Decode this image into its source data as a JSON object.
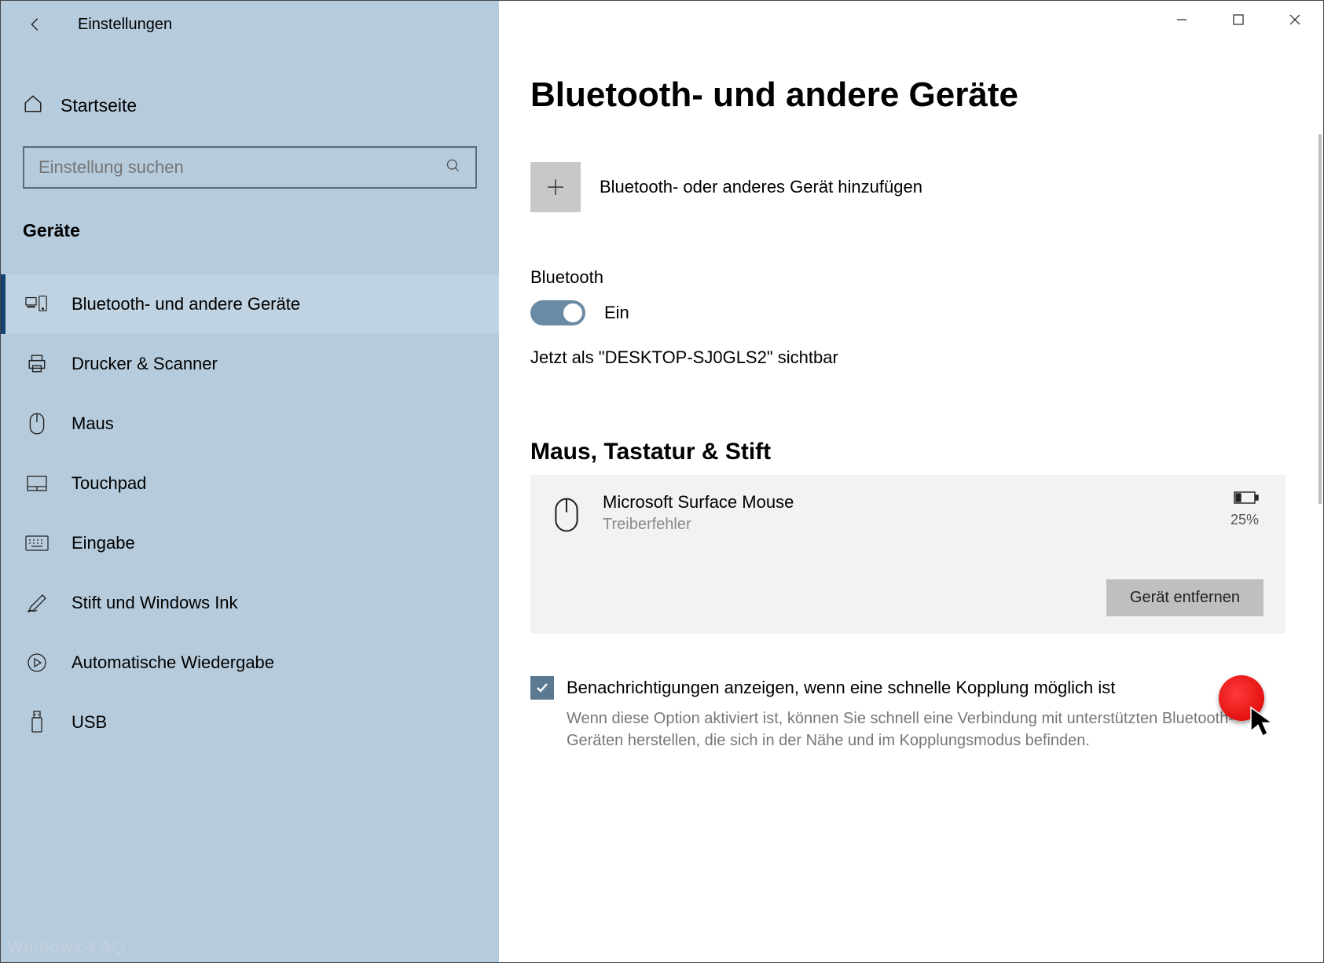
{
  "app": {
    "title": "Einstellungen"
  },
  "sidebar": {
    "home_label": "Startseite",
    "search_placeholder": "Einstellung suchen",
    "section_label": "Geräte",
    "items": [
      {
        "label": "Bluetooth- und andere Geräte",
        "icon": "devices-icon",
        "active": true
      },
      {
        "label": "Drucker & Scanner",
        "icon": "printer-icon",
        "active": false
      },
      {
        "label": "Maus",
        "icon": "mouse-icon",
        "active": false
      },
      {
        "label": "Touchpad",
        "icon": "touchpad-icon",
        "active": false
      },
      {
        "label": "Eingabe",
        "icon": "keyboard-icon",
        "active": false
      },
      {
        "label": "Stift und Windows Ink",
        "icon": "pen-icon",
        "active": false
      },
      {
        "label": "Automatische Wiedergabe",
        "icon": "autoplay-icon",
        "active": false
      },
      {
        "label": "USB",
        "icon": "usb-icon",
        "active": false
      }
    ]
  },
  "page": {
    "title": "Bluetooth- und andere Geräte",
    "add_device_label": "Bluetooth- oder anderes Gerät hinzufügen",
    "bluetooth_heading": "Bluetooth",
    "toggle_state_label": "Ein",
    "toggle_on": true,
    "visibility_text": "Jetzt als \"DESKTOP-SJ0GLS2\" sichtbar",
    "group_heading": "Maus, Tastatur & Stift",
    "device": {
      "name": "Microsoft Surface Mouse",
      "status": "Treiberfehler",
      "battery_pct": "25%",
      "remove_label": "Gerät entfernen"
    },
    "notify_checkbox_label": "Benachrichtigungen anzeigen, wenn eine schnelle Kopplung möglich ist",
    "notify_checkbox_desc": "Wenn diese Option aktiviert ist, können Sie schnell eine Verbindung mit unterstützten Bluetooth-Geräten herstellen, die sich in der Nähe und im Kopplungsmodus befinden.",
    "notify_checked": true
  },
  "watermark": "Windows-FAQ"
}
